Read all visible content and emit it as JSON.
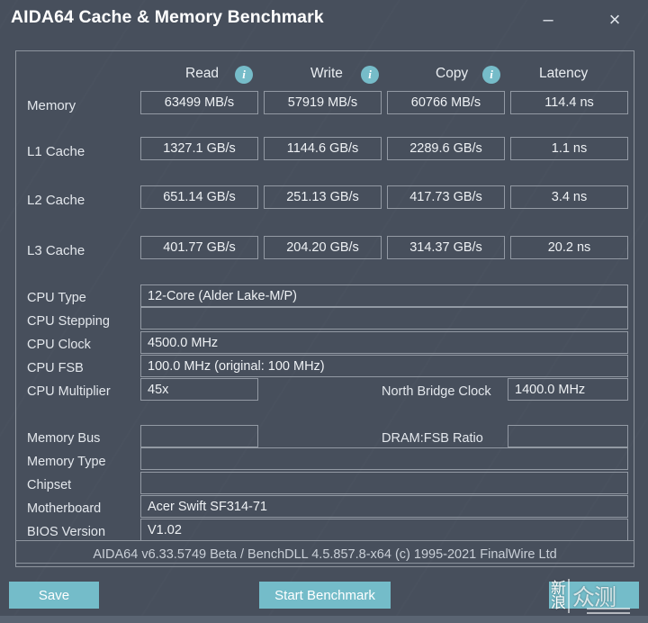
{
  "window": {
    "title": "AIDA64 Cache & Memory Benchmark",
    "minimize_label": "–",
    "close_label": "×"
  },
  "colors": {
    "background": "#474f5c",
    "accent": "#74bcc9",
    "border": "#8d949e",
    "text": "#e7eaee"
  },
  "benchmark_table": {
    "columns": [
      "Read",
      "Write",
      "Copy",
      "Latency"
    ],
    "info_icon_name": "info-icon",
    "rows": [
      {
        "label": "Memory",
        "read": "63499 MB/s",
        "write": "57919 MB/s",
        "copy": "60766 MB/s",
        "latency": "114.4 ns"
      },
      {
        "label": "L1 Cache",
        "read": "1327.1 GB/s",
        "write": "1144.6 GB/s",
        "copy": "2289.6 GB/s",
        "latency": "1.1 ns"
      },
      {
        "label": "L2 Cache",
        "read": "651.14 GB/s",
        "write": "251.13 GB/s",
        "copy": "417.73 GB/s",
        "latency": "3.4 ns"
      },
      {
        "label": "L3 Cache",
        "read": "401.77 GB/s",
        "write": "204.20 GB/s",
        "copy": "314.37 GB/s",
        "latency": "20.2 ns"
      }
    ]
  },
  "cpu_info": {
    "cpu_type_label": "CPU Type",
    "cpu_type_value": "12-Core   (Alder Lake-M/P)",
    "cpu_stepping_label": "CPU Stepping",
    "cpu_stepping_value": "",
    "cpu_clock_label": "CPU Clock",
    "cpu_clock_value": "4500.0 MHz",
    "cpu_fsb_label": "CPU FSB",
    "cpu_fsb_value": "100.0 MHz  (original: 100 MHz)",
    "cpu_multiplier_label": "CPU Multiplier",
    "cpu_multiplier_value": "45x",
    "north_bridge_clock_label": "North Bridge Clock",
    "north_bridge_clock_value": "1400.0 MHz"
  },
  "memory_info": {
    "memory_bus_label": "Memory Bus",
    "memory_bus_value": "",
    "dram_fsb_ratio_label": "DRAM:FSB Ratio",
    "dram_fsb_ratio_value": "",
    "memory_type_label": "Memory Type",
    "memory_type_value": "",
    "chipset_label": "Chipset",
    "chipset_value": "",
    "motherboard_label": "Motherboard",
    "motherboard_value": "Acer Swift SF314-71",
    "bios_version_label": "BIOS Version",
    "bios_version_value": "V1.02"
  },
  "footer": {
    "status": "AIDA64 v6.33.5749 Beta / BenchDLL 4.5.857.8-x64  (c) 1995-2021 FinalWire Ltd",
    "save_label": "Save",
    "start_benchmark_label": "Start Benchmark",
    "third_button_label": ""
  },
  "watermark": {
    "left_top": "新",
    "left_bottom": "浪",
    "right": "众测"
  }
}
